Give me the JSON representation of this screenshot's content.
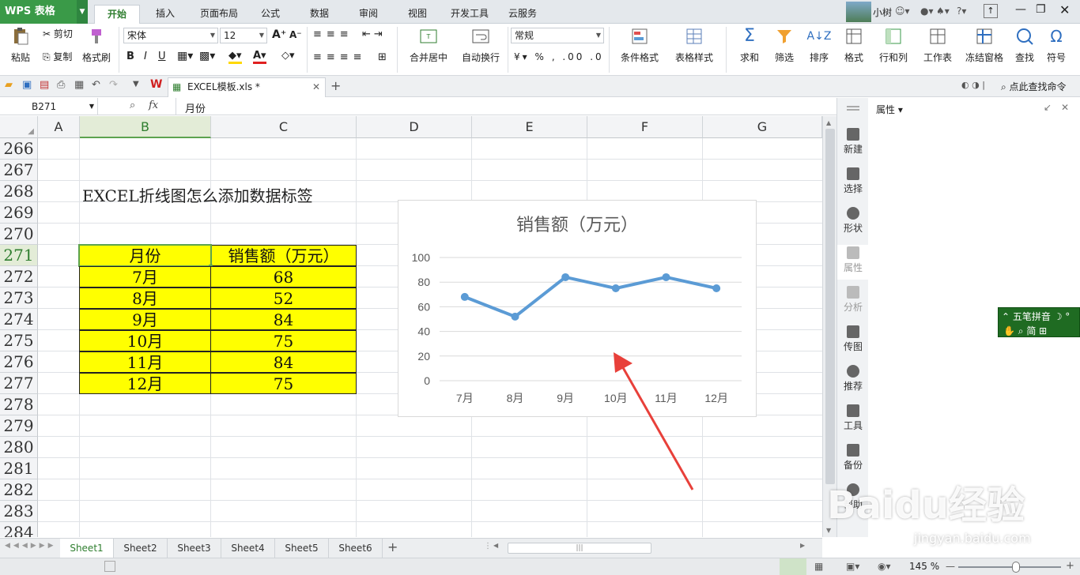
{
  "app": {
    "name": "WPS 表格",
    "user": "小树"
  },
  "menu_tabs": [
    "开始",
    "插入",
    "页面布局",
    "公式",
    "数据",
    "审阅",
    "视图",
    "开发工具",
    "云服务"
  ],
  "ribbon": {
    "paste": "粘贴",
    "cut": "剪切",
    "copy": "复制",
    "format_painter": "格式刷",
    "font_name": "宋体",
    "font_size": "12",
    "merge_center": "合并居中",
    "wrap_text": "自动换行",
    "number_format": "常规",
    "cond_format": "条件格式",
    "table_style": "表格样式",
    "sum": "求和",
    "filter": "筛选",
    "sort": "排序",
    "format": "格式",
    "row_col": "行和列",
    "worksheet": "工作表",
    "freeze": "冻结窗格",
    "find": "查找",
    "symbol": "符号"
  },
  "file_tab": {
    "name": "EXCEL模板.xls *"
  },
  "quick_search": "点此查找命令",
  "formula_bar": {
    "cell_ref": "B271",
    "fx": "fx",
    "content": "月份"
  },
  "columns": [
    "A",
    "B",
    "C",
    "D",
    "E",
    "F",
    "G"
  ],
  "rows": [
    "266",
    "267",
    "268",
    "269",
    "270",
    "271",
    "272",
    "273",
    "274",
    "275",
    "276",
    "277",
    "278",
    "279",
    "280",
    "281",
    "282",
    "283",
    "284"
  ],
  "sheet_title": "EXCEL折线图怎么添加数据标签",
  "table": {
    "header": [
      "月份",
      "销售额（万元）"
    ],
    "rows": [
      [
        "7月",
        "68"
      ],
      [
        "8月",
        "52"
      ],
      [
        "9月",
        "84"
      ],
      [
        "10月",
        "75"
      ],
      [
        "11月",
        "84"
      ],
      [
        "12月",
        "75"
      ]
    ]
  },
  "chart_data": {
    "type": "line",
    "title": "销售额（万元）",
    "categories": [
      "7月",
      "8月",
      "9月",
      "10月",
      "11月",
      "12月"
    ],
    "series": [
      {
        "values": [
          68,
          52,
          84,
          75,
          84,
          75
        ]
      }
    ],
    "ylim": [
      0,
      100
    ],
    "yticks": [
      0,
      20,
      40,
      60,
      80,
      100
    ],
    "grid": true,
    "line_color": "#5b9bd5"
  },
  "sidebar": [
    "新建",
    "选择",
    "形状",
    "属性",
    "分析",
    "传图",
    "推荐",
    "工具",
    "备份",
    "帮助"
  ],
  "props_pane": {
    "title": "属性"
  },
  "sheets": [
    "Sheet1",
    "Sheet2",
    "Sheet3",
    "Sheet4",
    "Sheet5",
    "Sheet6"
  ],
  "status": {
    "zoom": "145 %"
  },
  "ime": {
    "line1": "五笔拼音",
    "line2": "简"
  },
  "watermark": {
    "brand": "Baidu经验",
    "url": "jingyan.baidu.com"
  },
  "colors": {
    "accent": "#3a9a48",
    "highlight": "#ffff00",
    "arrow": "#e8403a"
  }
}
